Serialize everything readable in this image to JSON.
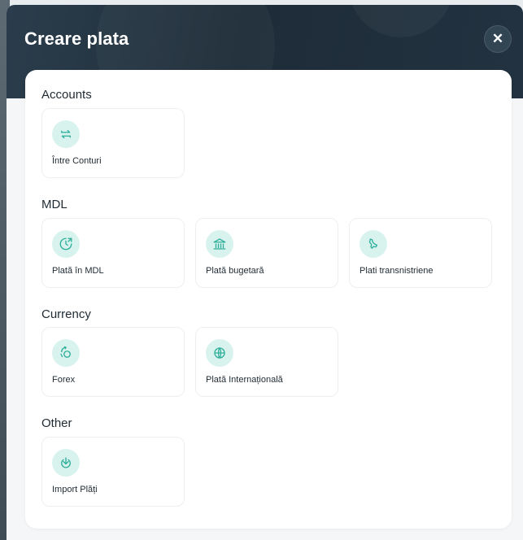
{
  "modal": {
    "title": "Creare plata",
    "close_glyph": "✕"
  },
  "sections": [
    {
      "title": "Accounts",
      "items": [
        {
          "label": "Între Conturi",
          "icon": "transfer-arrows-icon"
        }
      ]
    },
    {
      "title": "MDL",
      "items": [
        {
          "label": "Plată în MDL",
          "icon": "clock-arrow-icon"
        },
        {
          "label": "Plată bugetară",
          "icon": "government-building-icon"
        },
        {
          "label": "Plati transnistriene",
          "icon": "region-map-icon"
        }
      ]
    },
    {
      "title": "Currency",
      "items": [
        {
          "label": "Forex",
          "icon": "currency-exchange-icon"
        },
        {
          "label": "Plată Internațională",
          "icon": "globe-icon"
        }
      ]
    },
    {
      "title": "Other",
      "items": [
        {
          "label": "Import Plăți",
          "icon": "import-download-icon"
        }
      ]
    }
  ],
  "colors": {
    "header_bg": "#1e2c38",
    "icon_circle_bg": "#d8f3ee",
    "icon_stroke": "#2fae9a",
    "text": "#1f2a33"
  }
}
